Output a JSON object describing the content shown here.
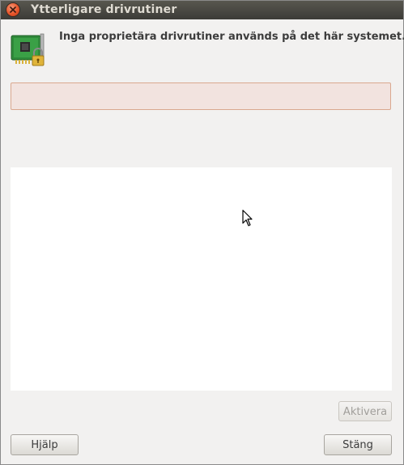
{
  "window": {
    "title": "Ytterligare drivrutiner"
  },
  "header": {
    "icon": "hardware-card-lock-icon",
    "message": "Inga proprietära drivrutiner används på det här systemet."
  },
  "buttons": {
    "activate_label": "Aktivera",
    "help_label": "Hjälp",
    "close_label": "Stäng"
  },
  "colors": {
    "titlebar": "#3c3b37",
    "close_button": "#e8552a",
    "info_bar_bg": "#f2e3df",
    "info_bar_border": "#d9a88f",
    "window_bg": "#f2f1f0"
  }
}
